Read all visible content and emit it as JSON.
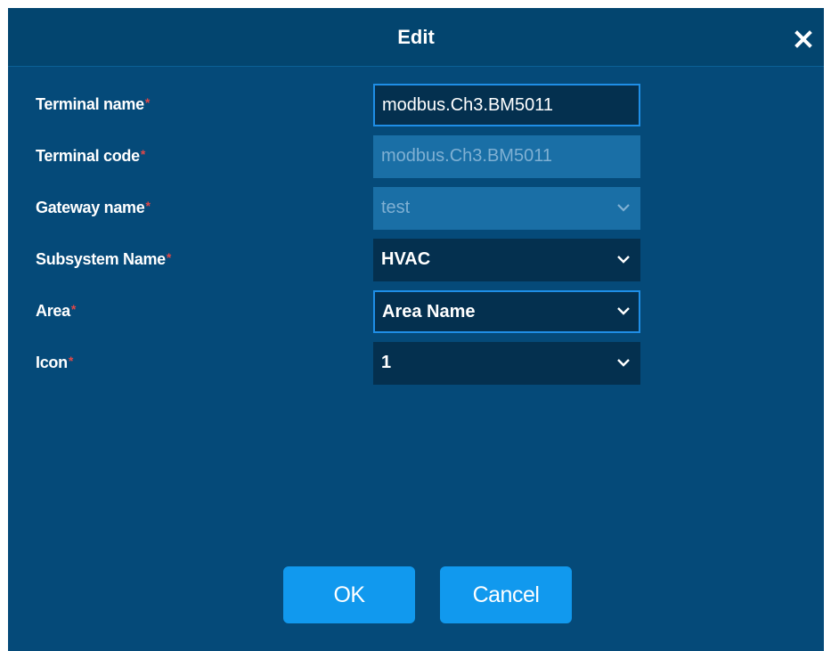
{
  "dialog": {
    "title": "Edit",
    "close_icon": "close-icon",
    "required_mark": "*"
  },
  "form": {
    "terminal_name": {
      "label": "Terminal name",
      "value": "modbus.Ch3.BM5011"
    },
    "terminal_code": {
      "label": "Terminal code",
      "value": "modbus.Ch3.BM5011"
    },
    "gateway_name": {
      "label": "Gateway name",
      "value": "test"
    },
    "subsystem_name": {
      "label": "Subsystem Name",
      "value": "HVAC"
    },
    "area": {
      "label": "Area",
      "value": "Area Name"
    },
    "icon": {
      "label": "Icon",
      "value": "1"
    }
  },
  "buttons": {
    "ok": "OK",
    "cancel": "Cancel"
  },
  "colors": {
    "dialog_bg": "#054a79",
    "input_bg": "#04304f",
    "disabled_bg": "#1a6fa6",
    "focus_border": "#1f8ee6",
    "button_bg": "#1199ee",
    "required": "#e04848"
  }
}
